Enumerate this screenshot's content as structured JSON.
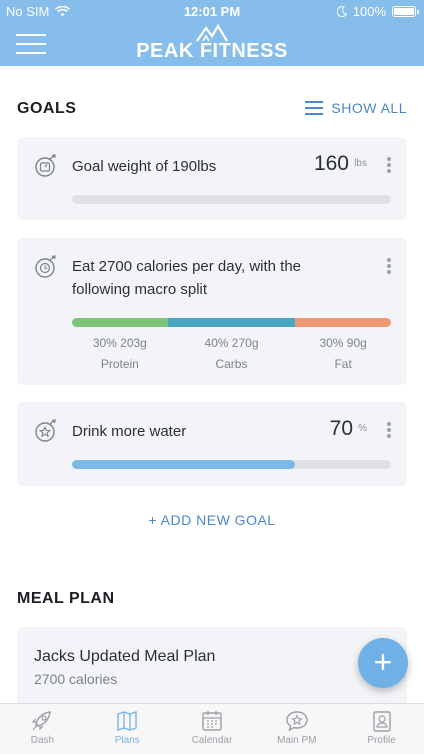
{
  "status_bar": {
    "carrier": "No SIM",
    "time": "12:01 PM",
    "battery": "100%",
    "battery_level": 1.0
  },
  "header": {
    "app_name": "PEAK FITNESS",
    "menu_icon": "hamburger-menu-icon",
    "logo_icon": "mountain-logo-icon"
  },
  "goals": {
    "section_title": "GOALS",
    "show_all_label": "SHOW ALL",
    "items": [
      {
        "icon": "target-scale-icon",
        "title": "Goal weight of 190lbs",
        "value": "160",
        "unit": "lbs",
        "progress": 0.0
      },
      {
        "icon": "target-clock-icon",
        "title": "Eat 2700 calories per day, with the following macro split",
        "macros": [
          {
            "percent_amount": "30% 203g",
            "name": "Protein",
            "share": 0.3,
            "color": "#7dc37a"
          },
          {
            "percent_amount": "40% 270g",
            "name": "Carbs",
            "share": 0.4,
            "color": "#4aa6c1"
          },
          {
            "percent_amount": "30% 90g",
            "name": "Fat",
            "share": 0.3,
            "color": "#ee9a77"
          }
        ]
      },
      {
        "icon": "target-star-icon",
        "title": "Drink more water",
        "value": "70",
        "unit": "%",
        "progress": 0.7
      }
    ],
    "add_goal_label": "+ ADD NEW GOAL"
  },
  "meal_plan": {
    "section_title": "MEAL PLAN",
    "card_title": "Jacks Updated Meal Plan",
    "card_subtitle": "2700 calories"
  },
  "fab_label": "+",
  "tabs": [
    {
      "label": "Dash",
      "icon": "rocket-icon",
      "active": false
    },
    {
      "label": "Plans",
      "icon": "map-icon",
      "active": true
    },
    {
      "label": "Calendar",
      "icon": "calendar-icon",
      "active": false
    },
    {
      "label": "Main PM",
      "icon": "star-chat-icon",
      "active": false
    },
    {
      "label": "Profile",
      "icon": "profile-card-icon",
      "active": false
    }
  ],
  "colors": {
    "header": "#86bdea",
    "accent": "#4a88c8",
    "water_fill": "#7ab8e6",
    "card_bg": "#f3f4f7"
  }
}
